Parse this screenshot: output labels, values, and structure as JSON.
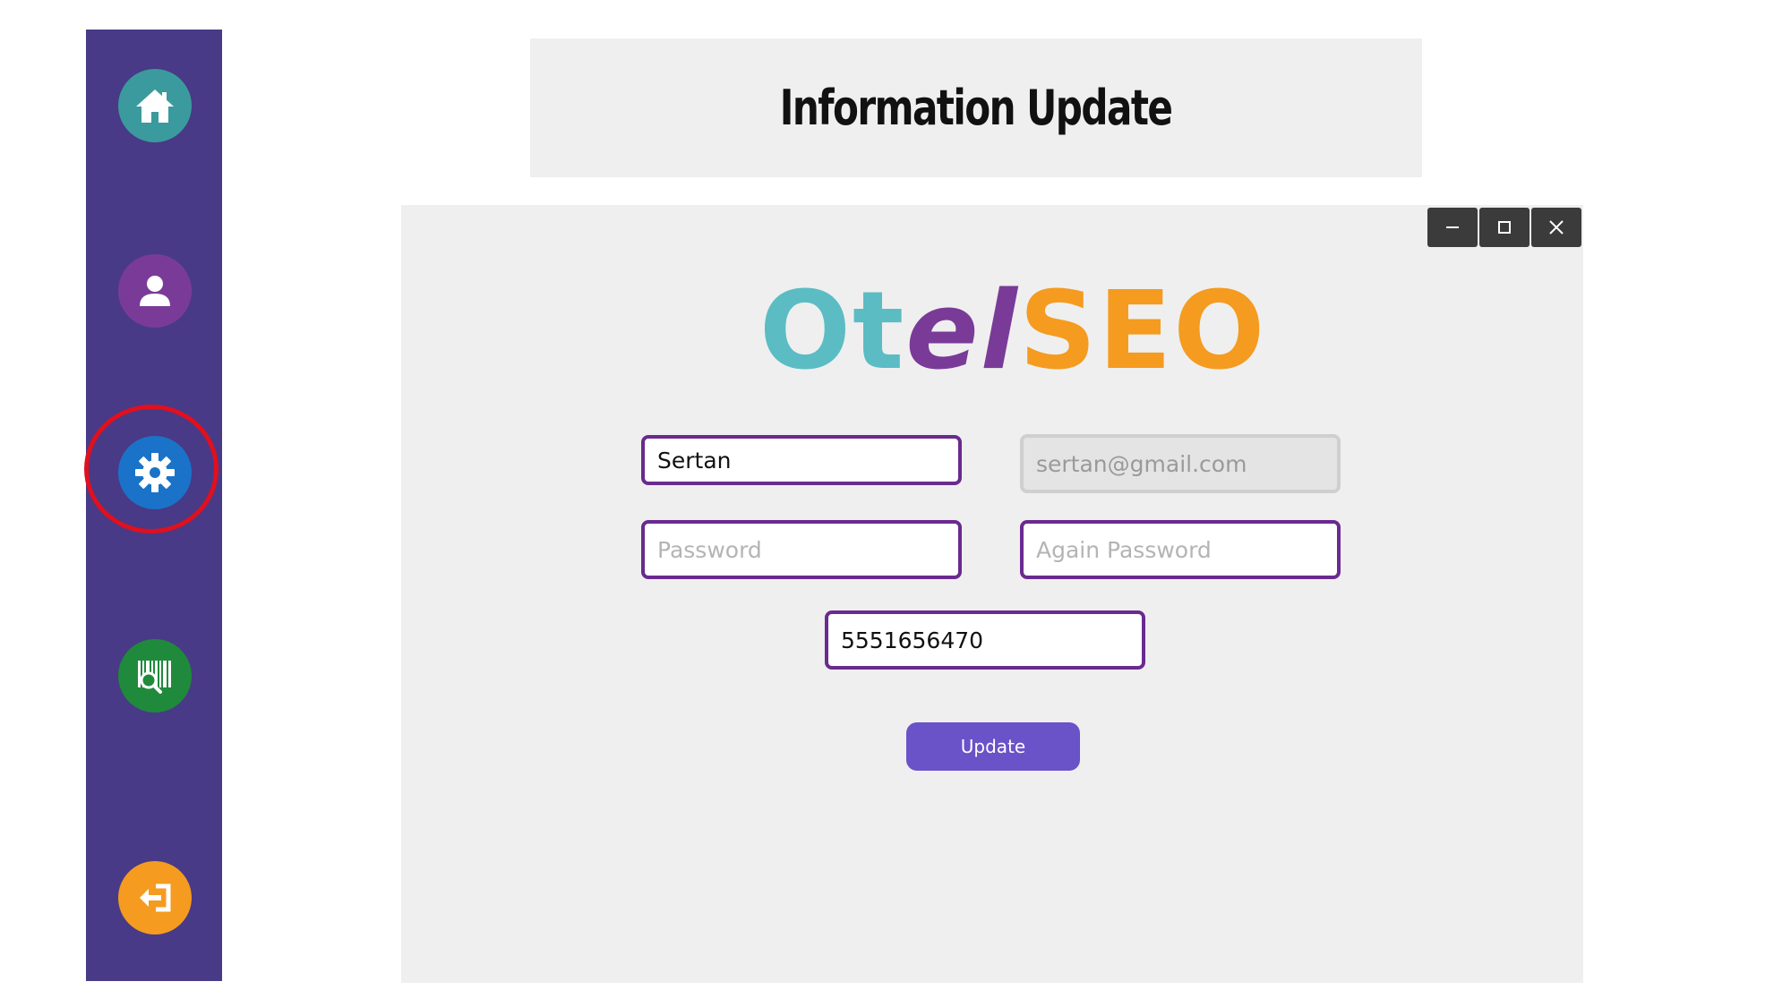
{
  "sidebar": {
    "items": [
      {
        "icon": "home-icon",
        "color": "#3b9a9d"
      },
      {
        "icon": "user-icon",
        "color": "#7a3b98"
      },
      {
        "icon": "gear-icon",
        "color": "#1a73c8",
        "highlighted": true
      },
      {
        "icon": "barcode-search-icon",
        "color": "#1f8a3b"
      },
      {
        "icon": "logout-icon",
        "color": "#f49b20"
      }
    ],
    "background": "#483a86",
    "highlight_color": "#e0101e"
  },
  "header": {
    "title": "Information Update"
  },
  "window": {
    "controls": [
      "minimize-icon",
      "maximize-icon",
      "close-icon"
    ],
    "logo": {
      "part1": "Ot",
      "part2": "el",
      "part3": "SEO"
    },
    "form": {
      "name_value": "Sertan",
      "email_value": "sertan@gmail.com",
      "password_placeholder": "Password",
      "password_again_placeholder": "Again Password",
      "phone_value": "5551656470"
    },
    "update_label": "Update"
  }
}
